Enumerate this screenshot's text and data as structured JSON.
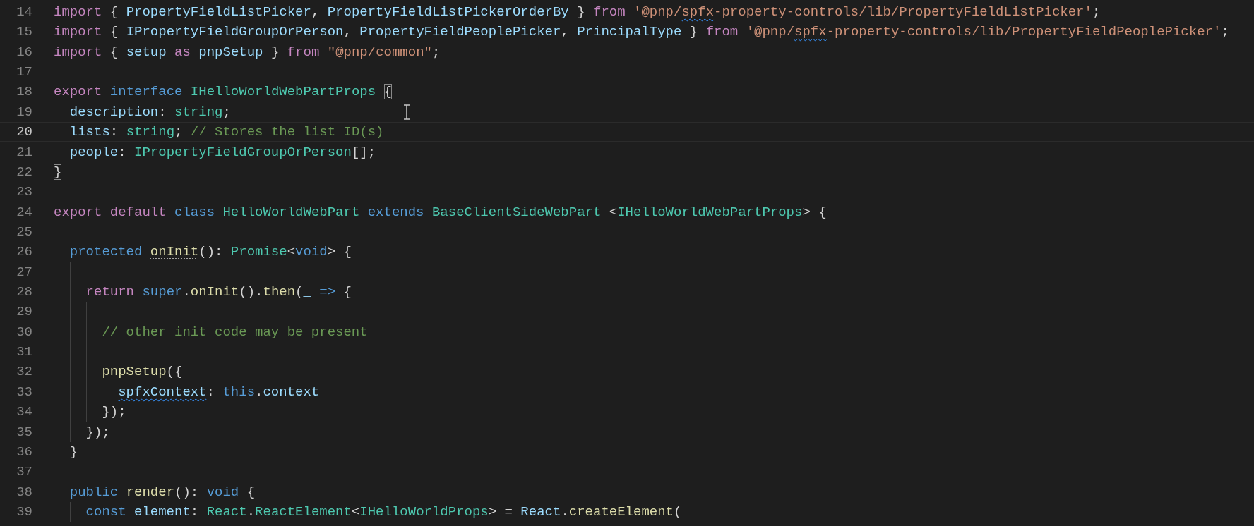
{
  "editor": {
    "lines": [
      {
        "number": "14",
        "current": false,
        "tokens": [
          {
            "kind": "control",
            "text": "import "
          },
          {
            "kind": "plain",
            "text": "{ "
          },
          {
            "kind": "variable",
            "text": "PropertyFieldListPicker"
          },
          {
            "kind": "plain",
            "text": ", "
          },
          {
            "kind": "variable",
            "text": "PropertyFieldListPickerOrderBy"
          },
          {
            "kind": "plain",
            "text": " } "
          },
          {
            "kind": "control",
            "text": "from "
          },
          {
            "kind": "string",
            "text": "'@pnp/"
          },
          {
            "kind": "string_wavy",
            "text": "spfx"
          },
          {
            "kind": "string",
            "text": "-property-controls/lib/PropertyFieldListPicker'"
          },
          {
            "kind": "plain",
            "text": ";"
          }
        ]
      },
      {
        "number": "15",
        "current": false,
        "tokens": [
          {
            "kind": "control",
            "text": "import "
          },
          {
            "kind": "plain",
            "text": "{ "
          },
          {
            "kind": "variable",
            "text": "IPropertyFieldGroupOrPerson"
          },
          {
            "kind": "plain",
            "text": ", "
          },
          {
            "kind": "variable",
            "text": "PropertyFieldPeoplePicker"
          },
          {
            "kind": "plain",
            "text": ", "
          },
          {
            "kind": "variable",
            "text": "PrincipalType"
          },
          {
            "kind": "plain",
            "text": " } "
          },
          {
            "kind": "control",
            "text": "from "
          },
          {
            "kind": "string",
            "text": "'@pnp/"
          },
          {
            "kind": "string_wavy",
            "text": "spfx"
          },
          {
            "kind": "string",
            "text": "-property-controls/lib/PropertyFieldPeoplePicker'"
          },
          {
            "kind": "plain",
            "text": ";"
          }
        ]
      },
      {
        "number": "16",
        "current": false,
        "tokens": [
          {
            "kind": "control",
            "text": "import "
          },
          {
            "kind": "plain",
            "text": "{ "
          },
          {
            "kind": "variable",
            "text": "setup "
          },
          {
            "kind": "control",
            "text": "as "
          },
          {
            "kind": "variable",
            "text": "pnpSetup"
          },
          {
            "kind": "plain",
            "text": " } "
          },
          {
            "kind": "control",
            "text": "from "
          },
          {
            "kind": "string",
            "text": "\"@pnp/common\""
          },
          {
            "kind": "plain",
            "text": ";"
          }
        ]
      },
      {
        "number": "17",
        "current": false
      },
      {
        "number": "18",
        "current": false,
        "tokens": [
          {
            "kind": "control",
            "text": "export "
          },
          {
            "kind": "keyword",
            "text": "interface "
          },
          {
            "kind": "type",
            "text": "IHelloWorldWebPartProps "
          },
          {
            "kind": "bracket",
            "text": "{"
          }
        ]
      },
      {
        "number": "19",
        "current": false,
        "tokens": [
          {
            "kind": "variable",
            "text": "  description"
          },
          {
            "kind": "plain",
            "text": ": "
          },
          {
            "kind": "type",
            "text": "string"
          },
          {
            "kind": "plain",
            "text": ";"
          }
        ]
      },
      {
        "number": "20",
        "current": true,
        "tokens": [
          {
            "kind": "variable",
            "text": "  lists"
          },
          {
            "kind": "plain",
            "text": ": "
          },
          {
            "kind": "type",
            "text": "string"
          },
          {
            "kind": "plain",
            "text": "; "
          },
          {
            "kind": "comment",
            "text": "// Stores the list ID(s)"
          }
        ]
      },
      {
        "number": "21",
        "current": false,
        "tokens": [
          {
            "kind": "variable",
            "text": "  people"
          },
          {
            "kind": "plain",
            "text": ": "
          },
          {
            "kind": "type",
            "text": "IPropertyFieldGroupOrPerson"
          },
          {
            "kind": "plain",
            "text": "[];"
          }
        ]
      },
      {
        "number": "22",
        "current": false,
        "tokens": [
          {
            "kind": "bracket",
            "text": "}"
          }
        ]
      },
      {
        "number": "23",
        "current": false
      },
      {
        "number": "24",
        "current": false,
        "tokens": [
          {
            "kind": "control",
            "text": "export "
          },
          {
            "kind": "control",
            "text": "default "
          },
          {
            "kind": "keyword",
            "text": "class "
          },
          {
            "kind": "type",
            "text": "HelloWorldWebPart "
          },
          {
            "kind": "keyword",
            "text": "extends "
          },
          {
            "kind": "type",
            "text": "BaseClientSideWebPart "
          },
          {
            "kind": "plain",
            "text": "<"
          },
          {
            "kind": "type",
            "text": "IHelloWorldWebPartProps"
          },
          {
            "kind": "plain",
            "text": "> {"
          }
        ]
      },
      {
        "number": "25",
        "current": false
      },
      {
        "number": "26",
        "current": false,
        "tokens": [
          {
            "kind": "keyword",
            "text": "  protected "
          },
          {
            "kind": "function_dotted",
            "text": "onInit"
          },
          {
            "kind": "plain",
            "text": "(): "
          },
          {
            "kind": "type",
            "text": "Promise"
          },
          {
            "kind": "plain",
            "text": "<"
          },
          {
            "kind": "keyword",
            "text": "void"
          },
          {
            "kind": "plain",
            "text": "> {"
          }
        ]
      },
      {
        "number": "27",
        "current": false
      },
      {
        "number": "28",
        "current": false,
        "tokens": [
          {
            "kind": "control",
            "text": "    return "
          },
          {
            "kind": "keyword",
            "text": "super"
          },
          {
            "kind": "plain",
            "text": "."
          },
          {
            "kind": "function",
            "text": "onInit"
          },
          {
            "kind": "plain",
            "text": "()."
          },
          {
            "kind": "function",
            "text": "then"
          },
          {
            "kind": "plain",
            "text": "("
          },
          {
            "kind": "variable",
            "text": "_ "
          },
          {
            "kind": "keyword",
            "text": "=>"
          },
          {
            "kind": "plain",
            "text": " {"
          }
        ]
      },
      {
        "number": "29",
        "current": false
      },
      {
        "number": "30",
        "current": false,
        "tokens": [
          {
            "kind": "comment",
            "text": "      // other init code may be present"
          }
        ]
      },
      {
        "number": "31",
        "current": false
      },
      {
        "number": "32",
        "current": false,
        "tokens": [
          {
            "kind": "function",
            "text": "      pnpSetup"
          },
          {
            "kind": "plain",
            "text": "({"
          }
        ]
      },
      {
        "number": "33",
        "current": false,
        "tokens": [
          {
            "kind": "variable_wavy",
            "text": "        spfxContext"
          },
          {
            "kind": "plain",
            "text": ": "
          },
          {
            "kind": "keyword",
            "text": "this"
          },
          {
            "kind": "plain",
            "text": "."
          },
          {
            "kind": "variable",
            "text": "context"
          }
        ]
      },
      {
        "number": "34",
        "current": false,
        "tokens": [
          {
            "kind": "plain",
            "text": "      });"
          }
        ]
      },
      {
        "number": "35",
        "current": false,
        "tokens": [
          {
            "kind": "plain",
            "text": "    });"
          }
        ]
      },
      {
        "number": "36",
        "current": false,
        "tokens": [
          {
            "kind": "plain",
            "text": "  }"
          }
        ]
      },
      {
        "number": "37",
        "current": false
      },
      {
        "number": "38",
        "current": false,
        "tokens": [
          {
            "kind": "keyword",
            "text": "  public "
          },
          {
            "kind": "function",
            "text": "render"
          },
          {
            "kind": "plain",
            "text": "(): "
          },
          {
            "kind": "keyword",
            "text": "void"
          },
          {
            "kind": "plain",
            "text": " {"
          }
        ]
      },
      {
        "number": "39",
        "current": false,
        "tokens": [
          {
            "kind": "keyword",
            "text": "    const "
          },
          {
            "kind": "variable",
            "text": "element"
          },
          {
            "kind": "plain",
            "text": ": "
          },
          {
            "kind": "type",
            "text": "React"
          },
          {
            "kind": "plain",
            "text": "."
          },
          {
            "kind": "type",
            "text": "ReactElement"
          },
          {
            "kind": "plain",
            "text": "<"
          },
          {
            "kind": "type",
            "text": "IHelloWorldProps"
          },
          {
            "kind": "plain",
            "text": "> = "
          },
          {
            "kind": "variable",
            "text": "React"
          },
          {
            "kind": "plain",
            "text": "."
          },
          {
            "kind": "function",
            "text": "createElement"
          },
          {
            "kind": "plain",
            "text": "("
          }
        ]
      }
    ]
  }
}
